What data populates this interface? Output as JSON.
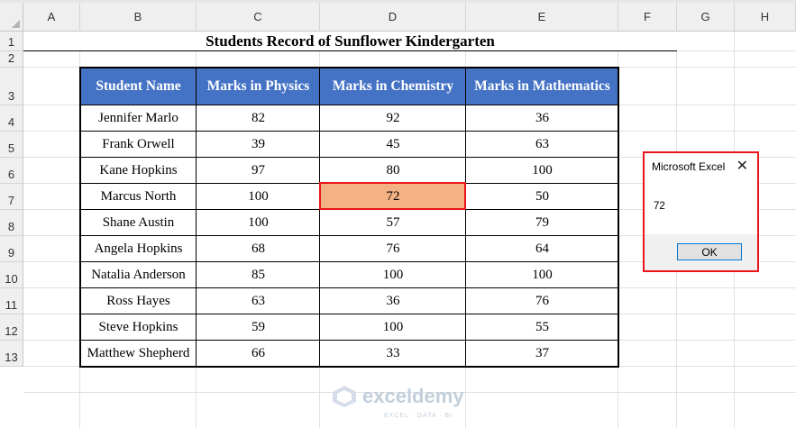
{
  "sheet": {
    "columns": [
      "A",
      "B",
      "C",
      "D",
      "E",
      "F",
      "G",
      "H"
    ],
    "rows": [
      "1",
      "2",
      "3",
      "4",
      "5",
      "6",
      "7",
      "8",
      "9",
      "10",
      "11",
      "12",
      "13"
    ],
    "title": "Students Record of Sunflower Kindergarten"
  },
  "table": {
    "headers": [
      "Student Name",
      "Marks in Physics",
      "Marks in Chemistry",
      "Marks in Mathematics"
    ],
    "rows": [
      [
        "Jennifer Marlo",
        "82",
        "92",
        "36"
      ],
      [
        "Frank Orwell",
        "39",
        "45",
        "63"
      ],
      [
        "Kane Hopkins",
        "97",
        "80",
        "100"
      ],
      [
        "Marcus North",
        "100",
        "72",
        "50"
      ],
      [
        "Shane Austin",
        "100",
        "57",
        "79"
      ],
      [
        "Angela Hopkins",
        "68",
        "76",
        "64"
      ],
      [
        "Natalia Anderson",
        "85",
        "100",
        "100"
      ],
      [
        "Ross Hayes",
        "63",
        "36",
        "76"
      ],
      [
        "Steve Hopkins",
        "59",
        "100",
        "55"
      ],
      [
        "Matthew Shepherd",
        "66",
        "33",
        "37"
      ]
    ],
    "highlight": {
      "row": 3,
      "col": 2
    }
  },
  "dialog": {
    "title": "Microsoft Excel",
    "close": "✕",
    "message": "72",
    "ok_label": "OK"
  },
  "watermark": {
    "name": "exceldemy",
    "tagline": "EXCEL · DATA · BI"
  },
  "colors": {
    "header_fill": "#4472c4",
    "highlight_fill": "#f4b183",
    "callout_border": "#e8151b"
  }
}
